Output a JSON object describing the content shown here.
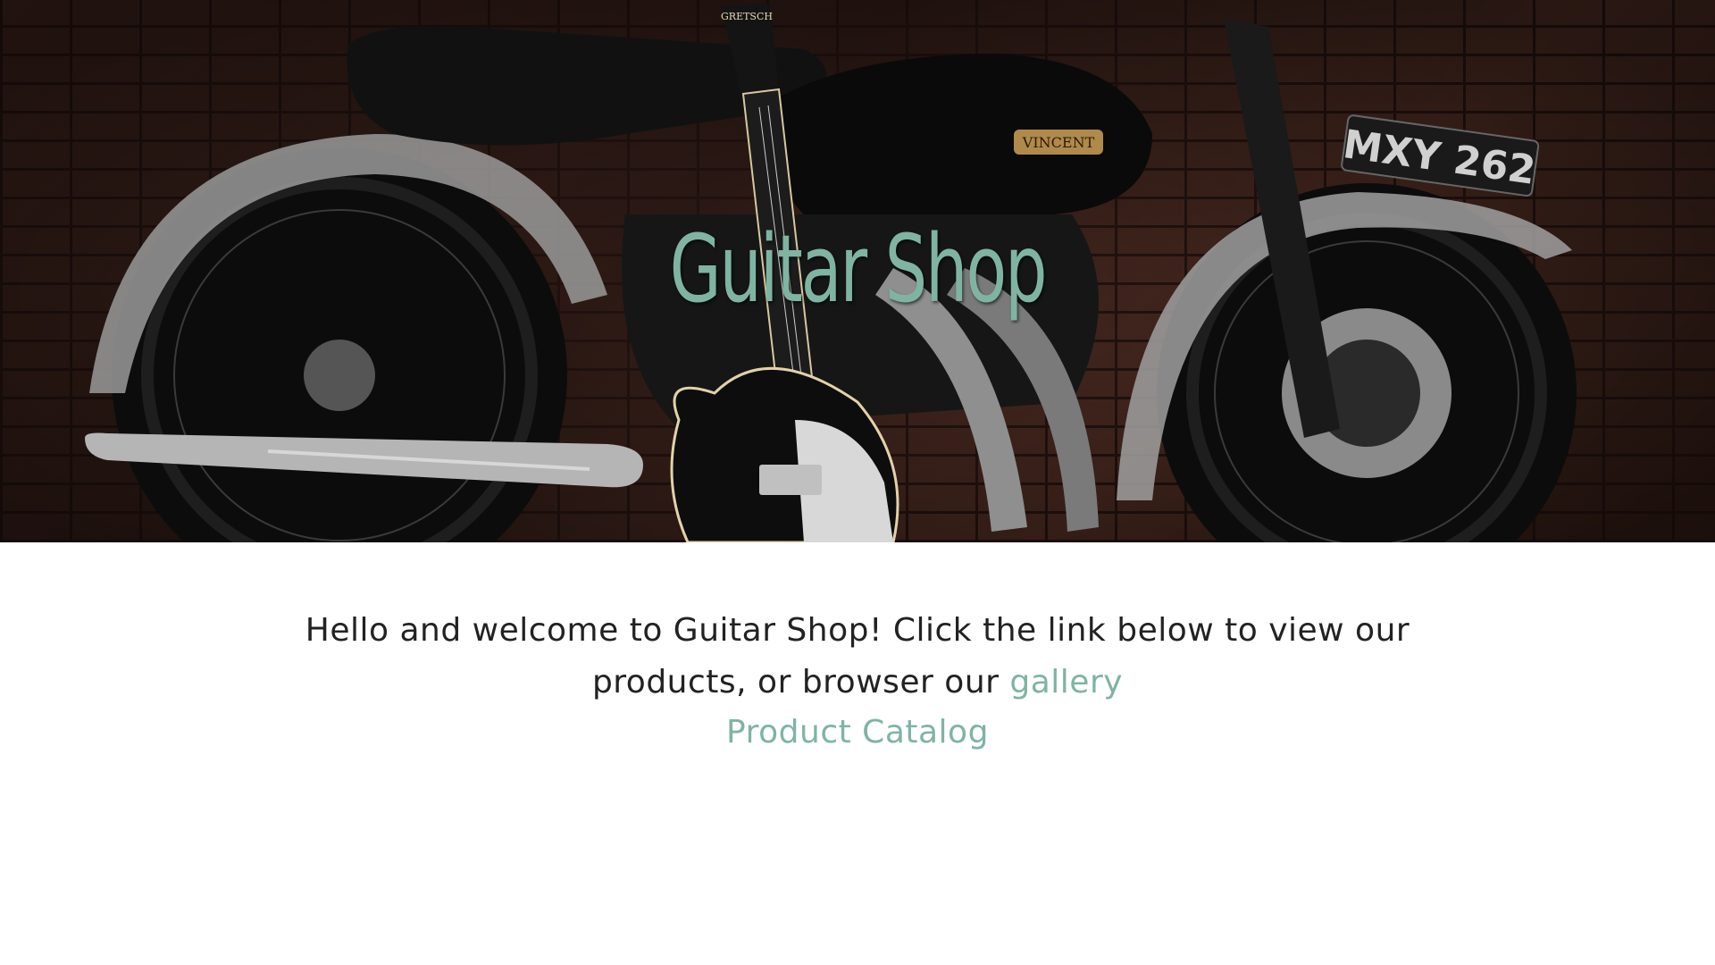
{
  "hero": {
    "title": "Guitar Shop",
    "image_alt": "Vincent motorcycle with a Gretsch guitar leaning against a brick wall",
    "plate_text": "MXY 262",
    "tank_badge": "VINCENT",
    "headstock_text": "GRETSCH"
  },
  "intro": {
    "text_before_link": "Hello and welcome to Guitar Shop! Click the link below to view our products, or browser our ",
    "gallery_link_label": "gallery"
  },
  "catalog_link_label": "Product Catalog",
  "colors": {
    "accent": "#7fb4a2",
    "text": "#222222",
    "background": "#ffffff"
  }
}
